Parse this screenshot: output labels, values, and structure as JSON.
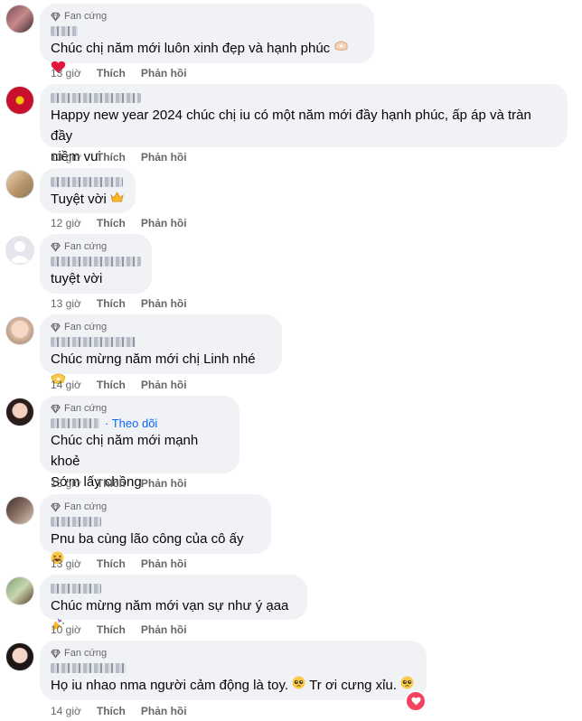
{
  "badge_label": "Fan cứng",
  "actions": {
    "like": "Thích",
    "reply": "Phản hồi"
  },
  "follow_label": "Theo dõi",
  "comments": [
    {
      "time": "13 giờ",
      "text": [
        "Chúc chị năm mới luôn xinh đẹp và hạnh phúc"
      ]
    },
    {
      "time": "13 giờ",
      "text": [
        "Happy new year 2024 chúc chị iu có một năm mới đầy hạnh phúc, ấp áp và tràn đầy",
        "niềm vui"
      ]
    },
    {
      "time": "12 giờ",
      "text": [
        "Tuyệt vời"
      ]
    },
    {
      "time": "13 giờ",
      "text": [
        "tuyệt vời"
      ]
    },
    {
      "time": "14 giờ",
      "text": [
        "Chúc mừng năm mới chị Linh nhé"
      ]
    },
    {
      "time": "13 giờ",
      "text": [
        "Chúc chị năm mới mạnh khoẻ",
        "Sớm lấy chồng"
      ]
    },
    {
      "time": "13 giờ",
      "text": [
        "Pnu ba cùng lão công của cô ấy"
      ]
    },
    {
      "time": "10 giờ",
      "text": [
        "Chúc mừng năm mới vạn sự như ý ạaa"
      ]
    },
    {
      "time": "14 giờ",
      "text": [
        "Họ iu nhao nma người cảm động là toy.",
        "Tr ơi cưng xỉu."
      ]
    }
  ],
  "colors": {
    "bubble": "#f0f2f5",
    "meta": "#65676b",
    "link": "#0866ff",
    "heart": "#f3425f"
  }
}
